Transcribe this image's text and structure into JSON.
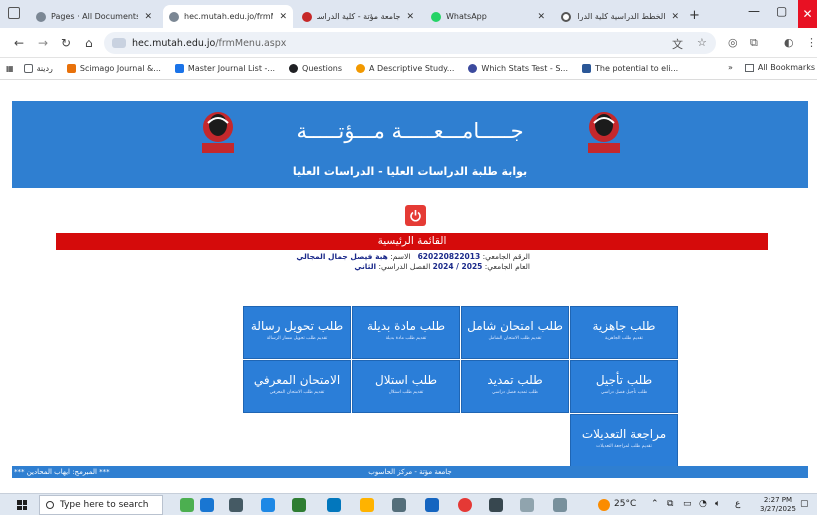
{
  "browser": {
    "tabs": [
      {
        "title": "Pages · All Documents",
        "fav_color": "#7b8794"
      },
      {
        "title": "hec.mutah.edu.jo/frmMe",
        "fav_color": "#7b8794"
      },
      {
        "title": "جامعة مؤتة - كلية الدراسات العليا",
        "fav_color": "#c62828"
      },
      {
        "title": "WhatsApp",
        "fav_color": "#25d366"
      },
      {
        "title": "الخطط الدراسية كلية الدرا",
        "fav_color": "#555555"
      }
    ],
    "new_tab": "+",
    "url_host": "hec.mutah.edu.jo",
    "url_path": "/frmMenu.aspx"
  },
  "bookmarks": {
    "items": [
      {
        "label": "ردينة",
        "color": "#5f6368"
      },
      {
        "label": "Scimago Journal &...",
        "color": "#e8710a"
      },
      {
        "label": "Master Journal List -...",
        "color": "#1a73e8"
      },
      {
        "label": "Questions",
        "color": "#202124"
      },
      {
        "label": "A Descriptive Study...",
        "color": "#f29900"
      },
      {
        "label": "Which Stats Test - S...",
        "color": "#3c4a9e"
      },
      {
        "label": "The potential to eli...",
        "color": "#2b5797"
      }
    ],
    "more": "»",
    "all": "All Bookmarks"
  },
  "header": {
    "university": "جـــــامـــعـــــة   مـــؤتـــــة",
    "portal": "بوابة طلبة الدراسات العليا - الدراسات العليا"
  },
  "main_menu_title": "القائمة الرئيسية",
  "student": {
    "id_label": "الرقم الجامعي:",
    "id": "620220822013",
    "name_label": "الاسم:",
    "name": "هبة فيصل جمال المجالي",
    "year_label": "العام الجامعي:",
    "year": "2024 / 2025",
    "semester_label": "الفصل الدراسي:",
    "semester": "الثاني"
  },
  "tiles": [
    {
      "title": "طلب جاهزية",
      "sub": "تقديم طلب الجاهزية"
    },
    {
      "title": "طلب امتحان شامل",
      "sub": "تقديم طلب الامتحان الشامل"
    },
    {
      "title": "طلب مادة بديلة",
      "sub": "تقديم طلب مادة بديلة"
    },
    {
      "title": "طلب تحويل رسالة",
      "sub": "تقديم طلب تحويل مسار الرسالة"
    },
    {
      "title": "طلب تأجيل",
      "sub": "طلب تأجيل فصل دراسي"
    },
    {
      "title": "طلب تمديد",
      "sub": "طلب تمديد فصل دراسي"
    },
    {
      "title": "طلب استلال",
      "sub": "تقديم طلب استلال"
    },
    {
      "title": "الامتحان المعرفي",
      "sub": "تقديم طلب الامتحان المعرفي"
    },
    {
      "title": "مراجعة التعديلات",
      "sub": "تقديم طلب لمراجعة التعديلات"
    }
  ],
  "footer": {
    "programmer": "*** المبرمج: ايهاب المحادين ***",
    "center": "جامعة مؤتة - مركز الحاسوب"
  },
  "taskbar": {
    "search_placeholder": "Type here to search",
    "weather": "25°C",
    "time": "2:27 PM",
    "date": "3/27/2025"
  }
}
